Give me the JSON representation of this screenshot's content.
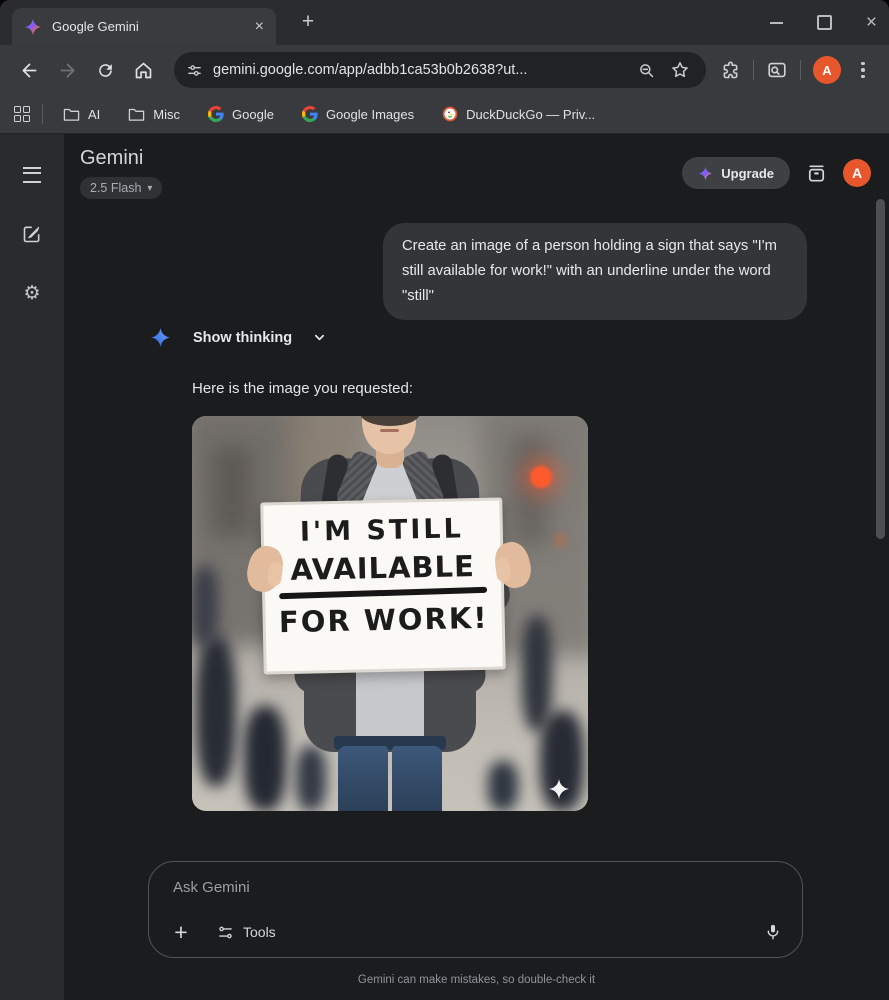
{
  "browser": {
    "tab_title": "Google Gemini",
    "tab_close": "×",
    "new_tab": "+",
    "window_close": "×",
    "url": "gemini.google.com/app/adbb1ca53b0b2638?ut...",
    "bookmarks": [
      {
        "label": "AI"
      },
      {
        "label": "Misc"
      },
      {
        "label": "Google"
      },
      {
        "label": "Google Images"
      },
      {
        "label": "DuckDuckGo — Priv..."
      }
    ],
    "profile_initial": "A"
  },
  "app": {
    "title": "Gemini",
    "model": "2.5 Flash",
    "model_caret": "▾",
    "upgrade": "Upgrade",
    "avatar_initial": "A"
  },
  "chat": {
    "user_message": "Create an image of a person holding a sign that says \"I'm still available for work!\" with an underline under the word \"still\"",
    "show_thinking": "Show thinking",
    "intro": "Here is the image you requested:",
    "sign": {
      "line1": "I'M STILL",
      "line2": "AVAILABLE",
      "line3": "FOR WORK!"
    }
  },
  "composer": {
    "placeholder": "Ask Gemini",
    "plus": "+",
    "tools": "Tools",
    "disclaimer": "Gemini can make mistakes, so double-check it"
  },
  "colors": {
    "avatar_orange": "#E8562B",
    "gemini_blue": "#4E86F0",
    "sign_ink": "#1C1C1C",
    "duckduckgo_orange": "#DE5833"
  }
}
